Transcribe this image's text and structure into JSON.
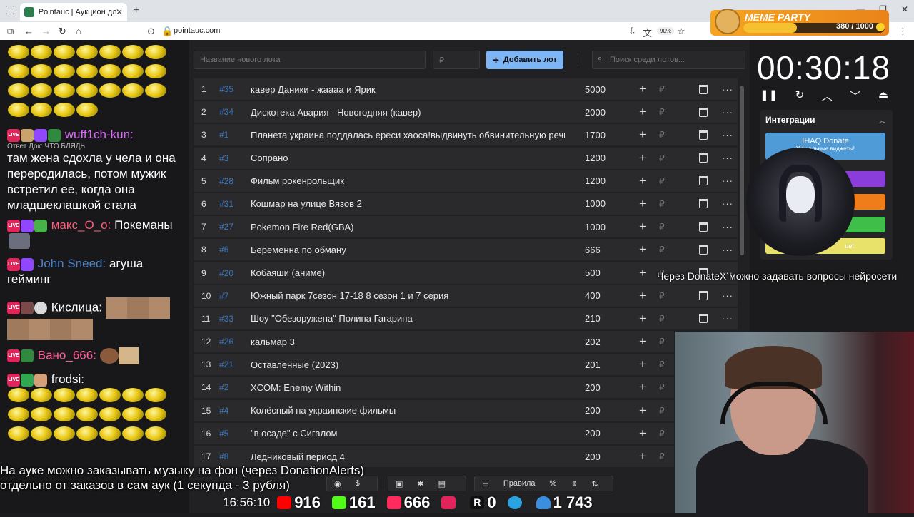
{
  "browser": {
    "tab_title": "Pointauc | Аукцион для стрим",
    "url": "pointauc.com",
    "zoom": "90%"
  },
  "meme_party": {
    "label": "MEME PARTY",
    "progress": "380 / 1000",
    "progress_fraction": 0.38
  },
  "chat": {
    "messages": [
      {
        "user": "wuff1ch-kun:",
        "user_color": "#d86ef5",
        "reply": "Ответ Док: ЧТО БЛЯДЬ",
        "text": "там жена сдохла у чела и она переродилась, потом мужик встретил ее, когда она младшеклашкой стала"
      },
      {
        "user": "макс_O_o:",
        "user_color": "#ff5b7a",
        "text": "Покеманы"
      },
      {
        "user": "John Sneed:",
        "user_color": "#4d82c9",
        "text": "агуша гейминг"
      },
      {
        "user": "Кислица:",
        "user_color": "#ffffff",
        "text": ""
      },
      {
        "user": "Вано_666:",
        "user_color": "#ff5b9a",
        "text": ""
      },
      {
        "user": "frodsi:",
        "user_color": "#ffffff",
        "text": ""
      }
    ]
  },
  "auction": {
    "new_lot_placeholder": "Название нового лота",
    "amount_placeholder": "₽",
    "add_button": "Добавить лот",
    "search_placeholder": "Поиск среди лотов...",
    "currency": "₽",
    "lots": [
      {
        "n": "1",
        "id": "#35",
        "title": "кавер Даники - жаааа и Ярик",
        "amount": "5000"
      },
      {
        "n": "2",
        "id": "#34",
        "title": "Дискотека Авария - Новогодняя (кавер)",
        "amount": "2000"
      },
      {
        "n": "3",
        "id": "#1",
        "title": "Планета украина поддалась ереси хаоса!выдвинуть обвинительную речь! по",
        "amount": "1700"
      },
      {
        "n": "4",
        "id": "#3",
        "title": "Сопрано",
        "amount": "1200"
      },
      {
        "n": "5",
        "id": "#28",
        "title": "Фильм рокенрольщик",
        "amount": "1200"
      },
      {
        "n": "6",
        "id": "#31",
        "title": "Кошмар на улице Вязов 2",
        "amount": "1000"
      },
      {
        "n": "7",
        "id": "#27",
        "title": "Pokemon Fire Red(GBA)",
        "amount": "1000"
      },
      {
        "n": "8",
        "id": "#6",
        "title": "Беременна по обману",
        "amount": "666"
      },
      {
        "n": "9",
        "id": "#20",
        "title": "Кобаяши (аниме)",
        "amount": "500"
      },
      {
        "n": "10",
        "id": "#7",
        "title": "Южный парк 7сезон 17-18 8 сезон 1 и 7 серия",
        "amount": "400"
      },
      {
        "n": "11",
        "id": "#33",
        "title": "Шоу \"Обезоружена\" Полина Гагарина",
        "amount": "210"
      },
      {
        "n": "12",
        "id": "#26",
        "title": "кальмар 3",
        "amount": "202"
      },
      {
        "n": "13",
        "id": "#21",
        "title": "Оставленные (2023)",
        "amount": "201"
      },
      {
        "n": "14",
        "id": "#2",
        "title": "XCOM: Enemy Within",
        "amount": "200"
      },
      {
        "n": "15",
        "id": "#4",
        "title": "Колёсный на украинские фильмы",
        "amount": "200"
      },
      {
        "n": "16",
        "id": "#5",
        "title": "\"в осаде\" с Сигалом",
        "amount": "200"
      },
      {
        "n": "17",
        "id": "#8",
        "title": "Ледниковый период 4",
        "amount": "200"
      }
    ]
  },
  "timer": {
    "value": "00:30:18"
  },
  "integrations": {
    "title": "Интеграции",
    "donate_title": "IHAQ Donate",
    "donate_sub": "Уникальные виджеты!",
    "last_label": "uet"
  },
  "overlay": {
    "donatex_note": "Через DonateX можно задавать вопросы нейросети"
  },
  "subtitle": {
    "line1": "На ауке можно заказывать музыку на фон (через DonationAlerts)",
    "line2": "отдельно от заказов в сам аук (1 секунда - 3 рубля)"
  },
  "toolbar": {
    "rules": "Правила",
    "percent": "%"
  },
  "stats": {
    "clock": "16:56:10",
    "youtube": "916",
    "kick": "161",
    "vk": "666",
    "rutube": "0",
    "telegram": "1 743"
  }
}
